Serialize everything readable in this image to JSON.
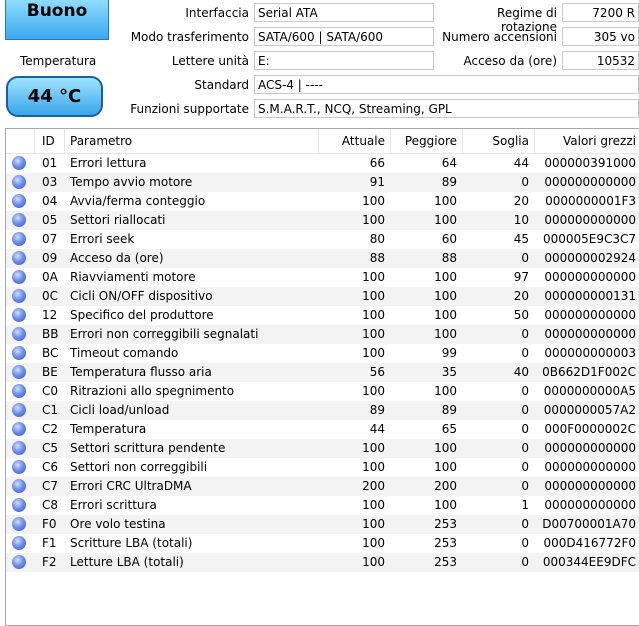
{
  "status": {
    "health": "Buono",
    "temperature_label": "Temperatura",
    "temperature": "44 °C"
  },
  "info": {
    "interface_label": "Interfaccia",
    "interface": "Serial ATA",
    "transfer_label": "Modo trasferimento",
    "transfer": "SATA/600 | SATA/600",
    "drive_letters_label": "Lettere unità",
    "drive_letters": "E:",
    "standard_label": "Standard",
    "standard": "ACS-4 | ----",
    "features_label": "Funzioni supportate",
    "features": "S.M.A.R.T., NCQ, Streaming, GPL",
    "rotation_label": "Regime di rotazione",
    "rotation": "7200 R",
    "power_count_label": "Numero accensioni",
    "power_count": "305 vo",
    "power_hours_label": "Acceso da (ore)",
    "power_hours": "10532"
  },
  "table": {
    "headers": {
      "id": "ID",
      "param": "Parametro",
      "current": "Attuale",
      "worst": "Peggiore",
      "threshold": "Soglia",
      "raw": "Valori grezzi"
    },
    "rows": [
      {
        "id": "01",
        "param": "Errori lettura",
        "current": "66",
        "worst": "64",
        "threshold": "44",
        "raw": "000000391000"
      },
      {
        "id": "03",
        "param": "Tempo avvio motore",
        "current": "91",
        "worst": "89",
        "threshold": "0",
        "raw": "000000000000"
      },
      {
        "id": "04",
        "param": "Avvia/ferma conteggio",
        "current": "100",
        "worst": "100",
        "threshold": "20",
        "raw": "0000000001F3"
      },
      {
        "id": "05",
        "param": "Settori riallocati",
        "current": "100",
        "worst": "100",
        "threshold": "10",
        "raw": "000000000000"
      },
      {
        "id": "07",
        "param": "Errori seek",
        "current": "80",
        "worst": "60",
        "threshold": "45",
        "raw": "000005E9C3C7"
      },
      {
        "id": "09",
        "param": "Acceso da (ore)",
        "current": "88",
        "worst": "88",
        "threshold": "0",
        "raw": "000000002924"
      },
      {
        "id": "0A",
        "param": "Riavviamenti motore",
        "current": "100",
        "worst": "100",
        "threshold": "97",
        "raw": "000000000000"
      },
      {
        "id": "0C",
        "param": "Cicli ON/OFF dispositivo",
        "current": "100",
        "worst": "100",
        "threshold": "20",
        "raw": "000000000131"
      },
      {
        "id": "12",
        "param": "Specifico del produttore",
        "current": "100",
        "worst": "100",
        "threshold": "50",
        "raw": "000000000000"
      },
      {
        "id": "BB",
        "param": "Errori non correggibili segnalati",
        "current": "100",
        "worst": "100",
        "threshold": "0",
        "raw": "000000000000"
      },
      {
        "id": "BC",
        "param": "Timeout comando",
        "current": "100",
        "worst": "99",
        "threshold": "0",
        "raw": "000000000003"
      },
      {
        "id": "BE",
        "param": "Temperatura flusso aria",
        "current": "56",
        "worst": "35",
        "threshold": "40",
        "raw": "0B662D1F002C"
      },
      {
        "id": "C0",
        "param": "Ritrazioni allo spegnimento",
        "current": "100",
        "worst": "100",
        "threshold": "0",
        "raw": "0000000000A5"
      },
      {
        "id": "C1",
        "param": "Cicli load/unload",
        "current": "89",
        "worst": "89",
        "threshold": "0",
        "raw": "0000000057A2"
      },
      {
        "id": "C2",
        "param": "Temperatura",
        "current": "44",
        "worst": "65",
        "threshold": "0",
        "raw": "000F0000002C"
      },
      {
        "id": "C5",
        "param": "Settori scrittura pendente",
        "current": "100",
        "worst": "100",
        "threshold": "0",
        "raw": "000000000000"
      },
      {
        "id": "C6",
        "param": "Settori non correggibili",
        "current": "100",
        "worst": "100",
        "threshold": "0",
        "raw": "000000000000"
      },
      {
        "id": "C7",
        "param": "Errori CRC UltraDMA",
        "current": "200",
        "worst": "200",
        "threshold": "0",
        "raw": "000000000000"
      },
      {
        "id": "C8",
        "param": "Errori scrittura",
        "current": "100",
        "worst": "100",
        "threshold": "1",
        "raw": "000000000000"
      },
      {
        "id": "F0",
        "param": "Ore volo testina",
        "current": "100",
        "worst": "253",
        "threshold": "0",
        "raw": "D00700001A70"
      },
      {
        "id": "F1",
        "param": "Scritture LBA (totali)",
        "current": "100",
        "worst": "253",
        "threshold": "0",
        "raw": "000D416772F0"
      },
      {
        "id": "F2",
        "param": "Letture LBA (totali)",
        "current": "100",
        "worst": "253",
        "threshold": "0",
        "raw": "000344EE9DFC"
      }
    ]
  },
  "colors": {
    "good": "#3aa9ee",
    "status_dot": "#4a5fd4"
  }
}
